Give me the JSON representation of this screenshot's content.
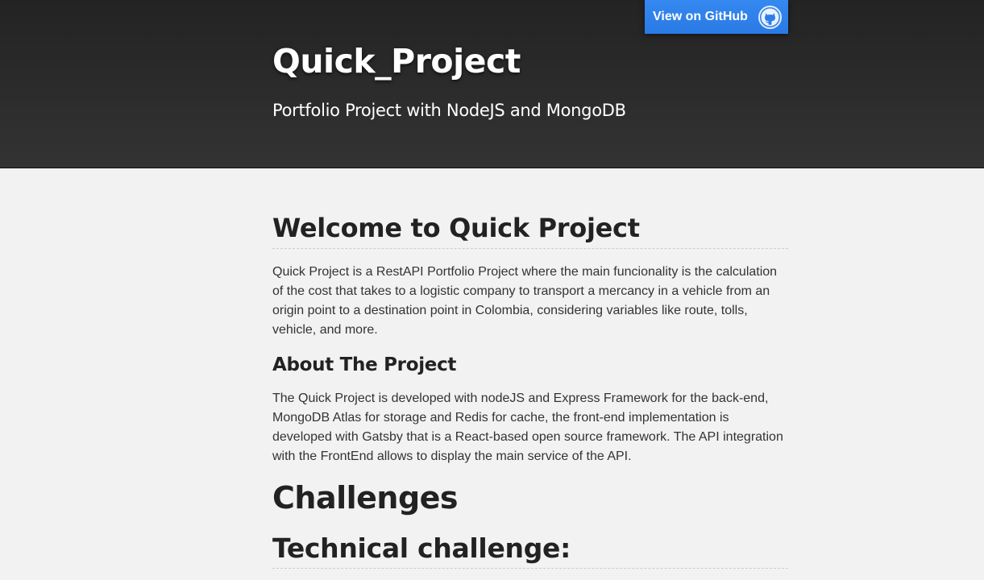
{
  "header": {
    "title": "Quick_Project",
    "tagline": "Portfolio Project with NodeJS and MongoDB",
    "github_button": {
      "label": "View on GitHub",
      "icon": "github-octocat-icon",
      "color": "#2b7de9"
    }
  },
  "main": {
    "welcome_heading": "Welcome to Quick Project",
    "intro_paragraph": "Quick Project is a RestAPI Portfolio Project where the main funcionality is the calculation of the cost that takes to a logistic company to transport a mercancy in a vehicle from an origin point to a destination point in Colombia, considering variables like route, tolls, vehicle, and more.",
    "about_heading": "About The Project",
    "about_paragraph": "The Quick Project is developed with nodeJS and Express Framework for the back-end, MongoDB Atlas for storage and Redis for cache, the front-end implementation is developed with Gatsby that is a React-based open source framework. The API integration with the FrontEnd allows to display the main service of the API.",
    "challenges_heading": "Challenges",
    "technical_heading": "Technical challenge:"
  },
  "colors": {
    "header_bg": "#2a2a2a",
    "page_bg": "#f2f2f2",
    "text": "#333333",
    "heading": "#222222",
    "accent": "#2b7de9"
  }
}
